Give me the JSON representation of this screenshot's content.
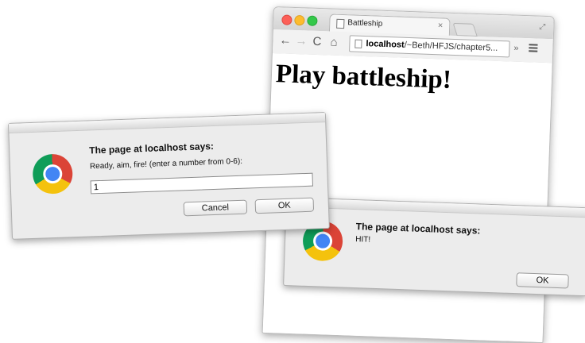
{
  "browser": {
    "tab_title": "Battleship",
    "url_host": "localhost",
    "url_path": "/~Beth/HFJS/chapter5...",
    "page_heading": "Play battleship!"
  },
  "prompt_dialog": {
    "title": "The page at localhost says:",
    "message": "Ready, aim, fire! (enter a number from 0-6):",
    "input_value": "1",
    "cancel_label": "Cancel",
    "ok_label": "OK"
  },
  "alert_dialog": {
    "title": "The page at localhost says:",
    "message": "HIT!",
    "ok_label": "OK"
  },
  "icons": {
    "back": "←",
    "forward": "→",
    "reload": "C",
    "home": "⌂",
    "close_tab": "×",
    "extensions": "»",
    "fullscreen": "⤢"
  }
}
